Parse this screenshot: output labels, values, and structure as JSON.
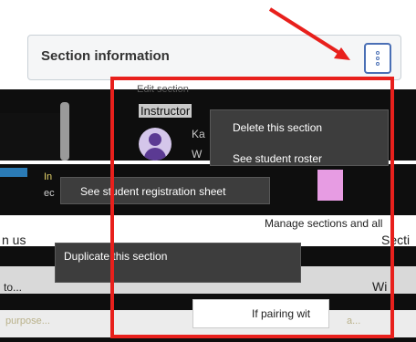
{
  "section_card": {
    "title": "Section information",
    "kebab_icon": "more-vertical-icon"
  },
  "menu": {
    "items": [
      {
        "label": "Delete this section"
      },
      {
        "label": "See student roster"
      },
      {
        "label": "See student registration sheet"
      },
      {
        "label": "Duplicate this section"
      }
    ]
  },
  "background_fragments": {
    "edit_hint": "Edit section",
    "instructor_label": "Instructor",
    "instructor_initial": "Ka",
    "line_w": "W",
    "left_fragment_1": "In",
    "left_fragment_2": "ec",
    "manage_fragment": "Manage sections and all",
    "left_us": "n us",
    "right_secti": "Secti",
    "bottom_left": "to...",
    "bottom_tooltip": "If pairing wit",
    "bottom_row_left": "purpose...",
    "bottom_row_right": "a...",
    "right_wi": "Wi"
  },
  "annotation": {
    "arrow_color": "#e8201c",
    "box_color": "#e8201c"
  }
}
